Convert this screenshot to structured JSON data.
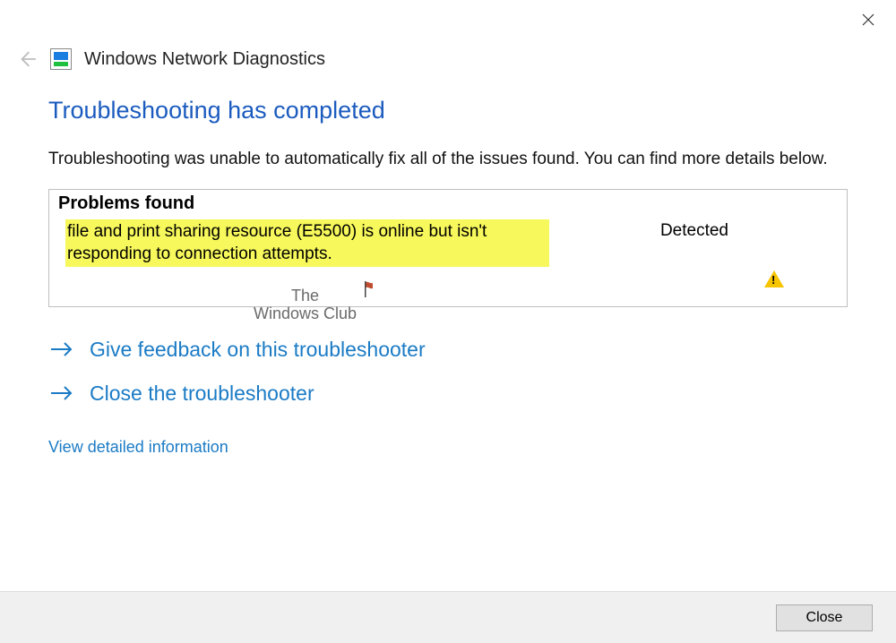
{
  "window": {
    "title": "Windows Network Diagnostics"
  },
  "heading": "Troubleshooting has completed",
  "subtext": "Troubleshooting was unable to automatically fix all of the issues found. You can find more details below.",
  "problems": {
    "header": "Problems found",
    "items": [
      {
        "text": "file and print sharing resource (E5500) is online but isn't responding to connection attempts.",
        "status": "Detected"
      }
    ]
  },
  "watermark": {
    "line1": "The",
    "line2": "Windows Club"
  },
  "actions": {
    "feedback": "Give feedback on this troubleshooter",
    "close_ts": "Close the troubleshooter"
  },
  "links": {
    "detailed": "View detailed information"
  },
  "footer": {
    "close": "Close"
  }
}
